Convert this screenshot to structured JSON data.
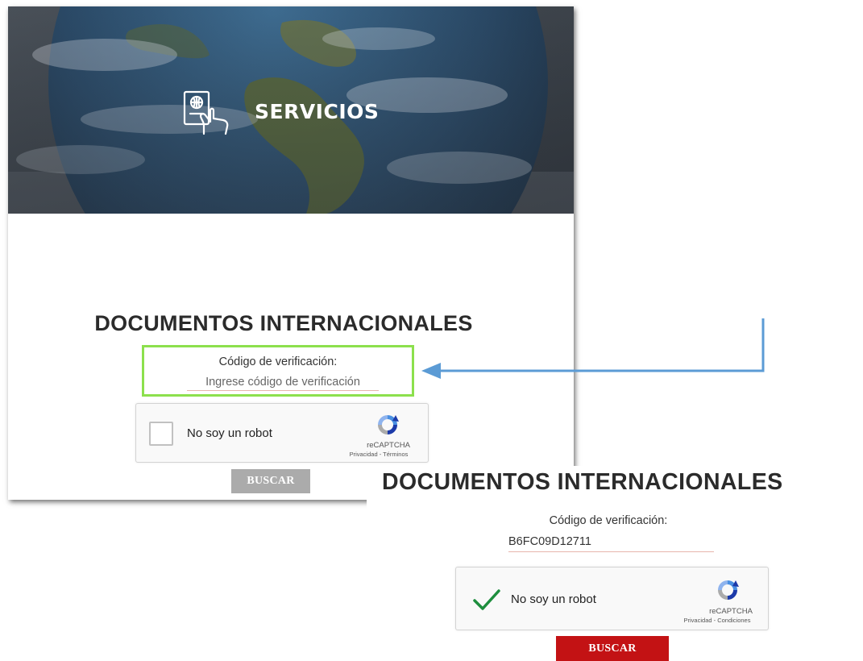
{
  "panel1": {
    "hero_title": "SERVICIOS",
    "hero_icon": "passport-hand-icon",
    "doc_title": "DOCUMENTOS INTERNACIONALES",
    "verification": {
      "label": "Código de verificación:",
      "value": "",
      "placeholder": "Ingrese código de verificación"
    },
    "captcha": {
      "label": "No soy un robot",
      "checked": false,
      "brand": "reCAPTCHA",
      "links": "Privacidad - Términos"
    },
    "search_button": "BUSCAR",
    "search_button_color": "#ababab"
  },
  "panel2": {
    "doc_title": "DOCUMENTOS INTERNACIONALES",
    "verification": {
      "label": "Código de verificación:",
      "value": "B6FC09D12711"
    },
    "captcha": {
      "label": "No soy un robot",
      "checked": true,
      "brand": "reCAPTCHA",
      "links": "Privacidad - Condiciones"
    },
    "search_button": "BUSCAR",
    "search_button_color": "#c31214"
  },
  "colors": {
    "highlight_border": "#8ce04d",
    "arrow": "#5b9bd5",
    "check": "#1e8e3e"
  }
}
